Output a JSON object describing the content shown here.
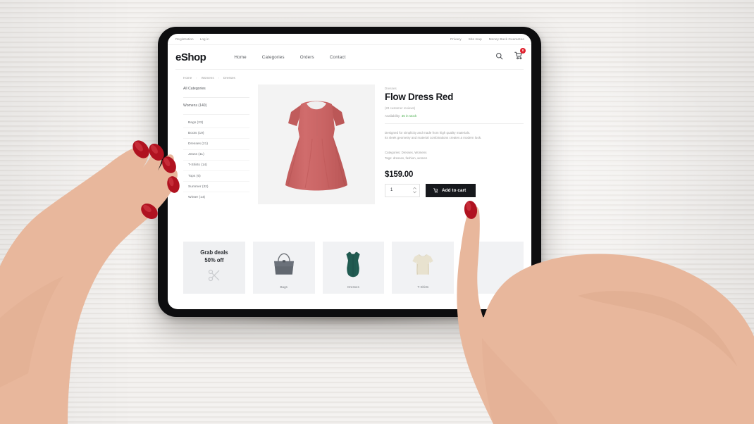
{
  "topbar": {
    "left": [
      {
        "label": "Registration",
        "name": "registration-link"
      },
      {
        "label": "Log in",
        "name": "login-link"
      }
    ],
    "right": [
      {
        "label": "Privacy",
        "name": "privacy-link"
      },
      {
        "label": "Site map",
        "name": "sitemap-link"
      },
      {
        "label": "Money Back Guarantee",
        "name": "money-back-guarantee-link"
      }
    ]
  },
  "header": {
    "logo": "eShop",
    "nav": [
      {
        "label": "Home",
        "name": "nav-home"
      },
      {
        "label": "Categories",
        "name": "nav-categories"
      },
      {
        "label": "Orders",
        "name": "nav-orders"
      },
      {
        "label": "Contact",
        "name": "nav-contact"
      }
    ],
    "search_icon": "search-icon",
    "cart_icon": "shopping-cart-icon",
    "cart_count": "0"
  },
  "breadcrumb": {
    "items": [
      "Home",
      "Womens",
      "Dresses"
    ],
    "separator": "›"
  },
  "sidebar": {
    "all_label": "All Categories",
    "group_label": "Womens (140)",
    "items": [
      {
        "label": "Bags (23)"
      },
      {
        "label": "Boots (19)"
      },
      {
        "label": "Dresses (21)"
      },
      {
        "label": "Jeans (11)"
      },
      {
        "label": "T-Shirts (14)"
      },
      {
        "label": "Tops (6)"
      },
      {
        "label": "Summer (32)"
      },
      {
        "label": "Winter (14)"
      }
    ]
  },
  "product": {
    "eyebrow": "Dresses",
    "title": "Flow Dress Red",
    "reviews": "(23 customer reviews)",
    "availability_label": "Availability:",
    "availability_value": "35 in stock",
    "description_line1": "Designed for simplicity and made from high quality materials.",
    "description_line2": "Its sleek geometry and material combinations creates a modern look.",
    "categories": "Categories: Dresses, Womens",
    "tags": "Tags: dresses, fashion, women",
    "price": "$159.00",
    "quantity": "1",
    "add_to_cart": "Add to cart",
    "image_alt": "red-flow-dress-photo",
    "accent_green": "#4caf50",
    "dress_color": "#cd6161"
  },
  "promo": {
    "deal": {
      "line1": "Grab deals",
      "line2": "50% off",
      "icon": "scissors-icon"
    },
    "cards": [
      {
        "label": "Bags",
        "art": "handbag-icon"
      },
      {
        "label": "Dresses",
        "art": "dress-icon"
      },
      {
        "label": "T-Shirts",
        "art": "tshirt-icon"
      },
      {
        "label": "",
        "art": "partially-hidden-card"
      }
    ]
  },
  "scene": {
    "device": "tablet",
    "left_hand": "resting-left-hand",
    "right_hand": "pointing-right-hand",
    "nail_color": "#b01220"
  }
}
